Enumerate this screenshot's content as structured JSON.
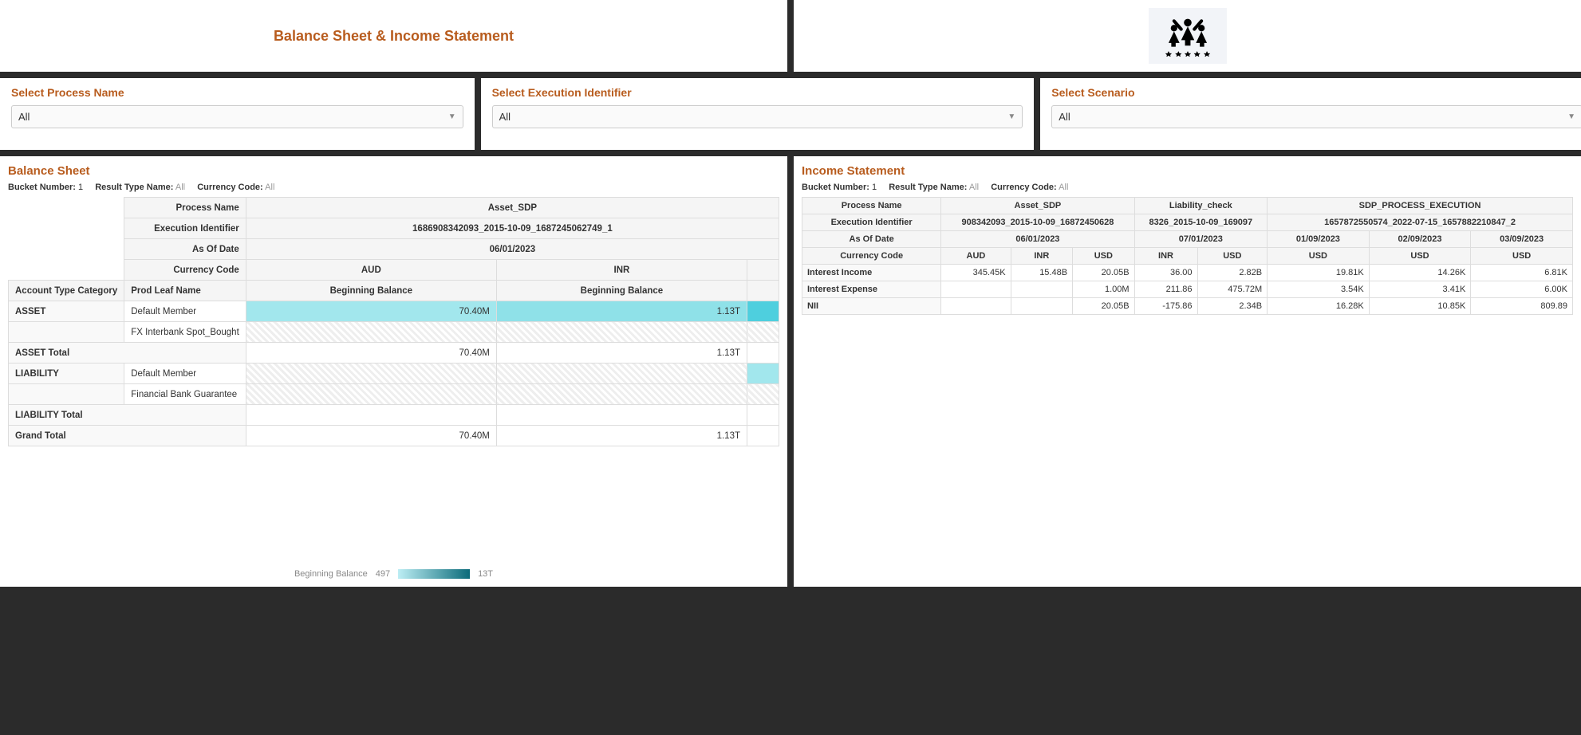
{
  "header": {
    "title": "Balance Sheet & Income Statement"
  },
  "filters": {
    "process": {
      "label": "Select Process Name",
      "value": "All"
    },
    "execution": {
      "label": "Select Execution Identifier",
      "value": "All"
    },
    "scenario": {
      "label": "Select Scenario",
      "value": "All"
    }
  },
  "balanceSheet": {
    "title": "Balance Sheet",
    "meta": {
      "bucketLabel": "Bucket Number:",
      "bucketVal": "1",
      "resultLabel": "Result Type Name:",
      "resultVal": "All",
      "currLabel": "Currency Code:",
      "currVal": "All"
    },
    "headers": {
      "processName": "Process Name",
      "processVal": "Asset_SDP",
      "execId": "Execution Identifier",
      "execVal": "1686908342093_2015-10-09_1687245062749_1",
      "asOf": "As Of Date",
      "asOfVal": "06/01/2023",
      "currCode": "Currency Code",
      "curr1": "AUD",
      "curr2": "INR",
      "acctCat": "Account Type Category",
      "prodLeaf": "Prod Leaf Name",
      "begBal": "Beginning Balance"
    },
    "rows": [
      {
        "cat": "ASSET",
        "leaf": "Default Member",
        "v1": "70.40M",
        "v2": "1.13T"
      },
      {
        "cat": "",
        "leaf": "FX Interbank Spot_Bought",
        "v1": "",
        "v2": ""
      },
      {
        "cat": "ASSET Total",
        "leaf": "",
        "v1": "70.40M",
        "v2": "1.13T"
      },
      {
        "cat": "LIABILITY",
        "leaf": "Default Member",
        "v1": "",
        "v2": ""
      },
      {
        "cat": "",
        "leaf": "Financial Bank Guarantee",
        "v1": "",
        "v2": ""
      },
      {
        "cat": "LIABILITY Total",
        "leaf": "",
        "v1": "",
        "v2": ""
      },
      {
        "cat": "Grand Total",
        "leaf": "",
        "v1": "70.40M",
        "v2": "1.13T"
      }
    ],
    "legend": {
      "label": "Beginning Balance",
      "min": "497",
      "max": "13T"
    }
  },
  "income": {
    "title": "Income Statement",
    "meta": {
      "bucketLabel": "Bucket Number:",
      "bucketVal": "1",
      "resultLabel": "Result Type Name:",
      "resultVal": "All",
      "currLabel": "Currency Code:",
      "currVal": "All"
    },
    "cols": {
      "processName": "Process Name",
      "p1": "Asset_SDP",
      "p2": "Liability_check",
      "p3": "SDP_PROCESS_EXECUTION",
      "execId": "Execution Identifier",
      "e1": "908342093_2015-10-09_16872450628",
      "e2": "8326_2015-10-09_169097",
      "e3": "1657872550574_2022-07-15_1657882210847_2",
      "asOf": "As Of Date",
      "d1": "06/01/2023",
      "d2": "07/01/2023",
      "d3": "01/09/2023",
      "d4": "02/09/2023",
      "d5": "03/09/2023",
      "curr": "Currency Code",
      "c1": "AUD",
      "c2": "INR",
      "c3": "USD",
      "c4": "INR",
      "c5": "USD",
      "c6": "USD",
      "c7": "USD",
      "c8": "USD"
    },
    "rows": [
      {
        "label": "Interest Income",
        "v": [
          "345.45K",
          "15.48B",
          "20.05B",
          "36.00",
          "2.82B",
          "19.81K",
          "14.26K",
          "6.81K"
        ]
      },
      {
        "label": "Interest Expense",
        "v": [
          "",
          "",
          "1.00M",
          "211.86",
          "475.72M",
          "3.54K",
          "3.41K",
          "6.00K"
        ]
      },
      {
        "label": "NII",
        "v": [
          "",
          "",
          "20.05B",
          "-175.86",
          "2.34B",
          "16.28K",
          "10.85K",
          "809.89"
        ]
      }
    ]
  }
}
